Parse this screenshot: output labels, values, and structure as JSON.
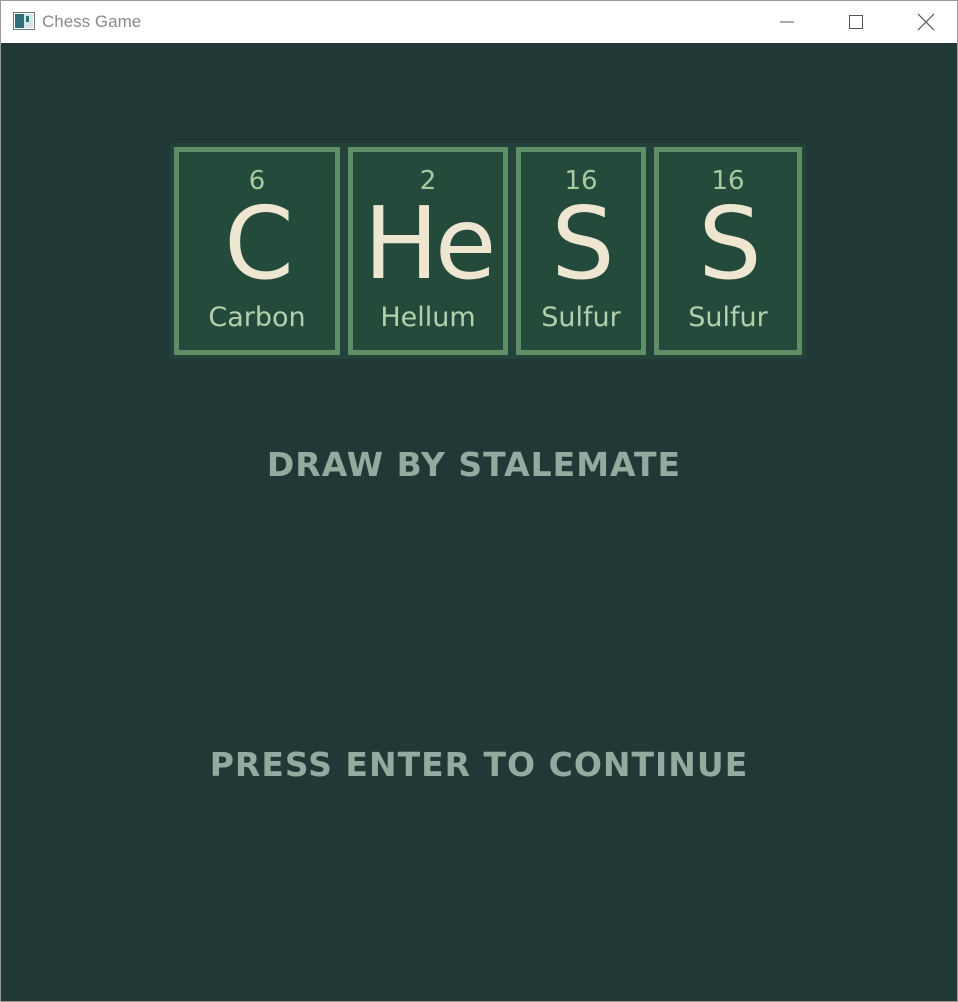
{
  "window": {
    "title": "Chess Game",
    "controls": {
      "minimize": "minimize-icon",
      "maximize": "maximize-icon",
      "close": "close-icon"
    }
  },
  "logo": {
    "tiles": [
      {
        "number": "6",
        "symbol": "C",
        "name": "Carbon"
      },
      {
        "number": "2",
        "symbol": "He",
        "name": "Hellum"
      },
      {
        "number": "16",
        "symbol": "S",
        "name": "Sulfur"
      },
      {
        "number": "16",
        "symbol": "S",
        "name": "Sulfur"
      }
    ]
  },
  "messages": {
    "result": "DRAW BY STALEMATE",
    "prompt": "PRESS ENTER TO CONTINUE"
  },
  "colors": {
    "background": "#213936",
    "tile_border": "#5f8f66",
    "tile_fill": "#234a3a",
    "symbol": "#efe6d2",
    "text": "#92aa9f"
  }
}
